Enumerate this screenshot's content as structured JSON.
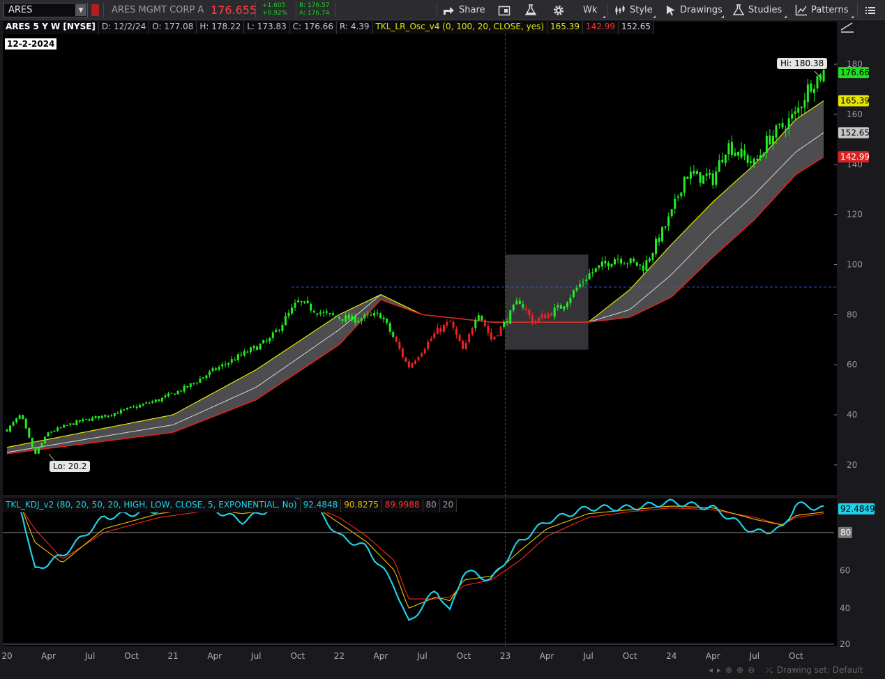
{
  "toolbar": {
    "symbol": "ARES",
    "company": "ARES MGMT CORP A",
    "last": "176.655",
    "change": "+1.605",
    "change_pct": "+0.92%",
    "bid": "B: 176.57",
    "ask": "A: 176.74",
    "share": "Share",
    "timeframe": "Wk",
    "style": "Style",
    "drawings": "Drawings",
    "studies": "Studies",
    "patterns": "Patterns",
    "icons": [
      "share-icon",
      "calendar-icon",
      "flask-icon",
      "gear-icon",
      "style-icon",
      "drawings-icon",
      "studies-icon",
      "patterns-icon",
      "menu-icon"
    ]
  },
  "legend": {
    "title": "ARES 5 Y W [NYSE]",
    "date": "D: 12/2/24",
    "open": "O: 177.08",
    "high": "H: 178.22",
    "low": "L: 173.83",
    "close": "C: 176.66",
    "range": "R: 4.39",
    "study": "TKL_LR_Osc_v4 (0, 100, 20, CLOSE, yes)",
    "study_v1": "165.39",
    "study_v2": "142.99",
    "study_v3": "152.65",
    "date_badge": "12-2-2024",
    "hi_label": "Hi: 180.38",
    "lo_label": "Lo: 20.2"
  },
  "kdj": {
    "title": "TKL_KDJ_v2 (80, 20, 50, 20, HIGH, LOW, CLOSE, 5, EXPONENTIAL, No)",
    "v1": "92.4848",
    "v2": "90.8275",
    "v3": "89.9988",
    "v4": "80",
    "v5": "20",
    "badge_value": "92.4849",
    "badge_80": "80"
  },
  "price_axis": {
    "ticks": [
      20,
      40,
      60,
      80,
      100,
      120,
      140,
      160,
      180
    ],
    "badges": [
      {
        "value": "176.66",
        "color": "#22dd22",
        "text_color": "#000"
      },
      {
        "value": "165.39",
        "color": "#e6e600",
        "text_color": "#000"
      },
      {
        "value": "152.65",
        "color": "#c8c8c8",
        "text_color": "#000"
      },
      {
        "value": "142.99",
        "color": "#dd2222",
        "text_color": "#fff"
      }
    ]
  },
  "kdj_axis": {
    "ticks": [
      20,
      40,
      60,
      80
    ]
  },
  "time_axis": [
    "20",
    "Apr",
    "Jul",
    "Oct",
    "21",
    "Apr",
    "Jul",
    "Oct",
    "22",
    "Apr",
    "Jul",
    "Oct",
    "23",
    "Apr",
    "Jul",
    "Oct",
    "24",
    "Apr",
    "Jul",
    "Oct"
  ],
  "status": {
    "drawing_set": "Drawing set: Default"
  },
  "chart_data": {
    "type": "candlestick",
    "title": "ARES 5 Y W [NYSE]",
    "price_range": [
      8,
      197
    ],
    "kdj_range": [
      20,
      98
    ],
    "reference_level": 91,
    "highlight_box": {
      "from": "2023-01",
      "to": "2023-07",
      "low": 66,
      "high": 104
    },
    "close_anchors": [
      [
        "2020-01",
        34
      ],
      [
        "2020-02",
        40
      ],
      [
        "2020-03",
        24
      ],
      [
        "2020-04",
        33
      ],
      [
        "2020-06",
        37
      ],
      [
        "2020-09",
        41
      ],
      [
        "2020-12",
        46
      ],
      [
        "2021-02",
        51
      ],
      [
        "2021-04",
        58
      ],
      [
        "2021-06",
        64
      ],
      [
        "2021-08",
        70
      ],
      [
        "2021-10",
        85
      ],
      [
        "2021-12",
        80
      ],
      [
        "2022-02",
        78
      ],
      [
        "2022-04",
        80
      ],
      [
        "2022-05",
        70
      ],
      [
        "2022-06",
        59
      ],
      [
        "2022-08",
        73
      ],
      [
        "2022-09",
        77
      ],
      [
        "2022-10",
        65
      ],
      [
        "2022-11",
        82
      ],
      [
        "2022-12",
        70
      ],
      [
        "2023-01",
        77
      ],
      [
        "2023-02",
        86
      ],
      [
        "2023-03",
        77
      ],
      [
        "2023-05",
        83
      ],
      [
        "2023-07",
        96
      ],
      [
        "2023-09",
        103
      ],
      [
        "2023-11",
        99
      ],
      [
        "2024-01",
        120
      ],
      [
        "2024-02",
        136
      ],
      [
        "2024-04",
        134
      ],
      [
        "2024-05",
        148
      ],
      [
        "2024-07",
        140
      ],
      [
        "2024-08",
        150
      ],
      [
        "2024-10",
        160
      ],
      [
        "2024-11",
        172
      ],
      [
        "2024-12",
        176.66
      ]
    ],
    "lr_band_anchors": [
      [
        "2020-01",
        27,
        25,
        24.5
      ],
      [
        "2021-01",
        40,
        36,
        33
      ],
      [
        "2021-07",
        58,
        51,
        46
      ],
      [
        "2022-01",
        80,
        74,
        68
      ],
      [
        "2022-04",
        88,
        88,
        86
      ],
      [
        "2022-07",
        80,
        80,
        80
      ],
      [
        "2022-12",
        77,
        77,
        77
      ],
      [
        "2023-07",
        77,
        77,
        77
      ],
      [
        "2023-10",
        90,
        82,
        79
      ],
      [
        "2024-01",
        108,
        96,
        87
      ],
      [
        "2024-04",
        125,
        113,
        103
      ],
      [
        "2024-07",
        140,
        128,
        118
      ],
      [
        "2024-10",
        158,
        145,
        136
      ],
      [
        "2024-12",
        165.39,
        152.65,
        142.99
      ]
    ],
    "kdj_anchors": [
      [
        "2020-01",
        96,
        95,
        94
      ],
      [
        "2020-02",
        94,
        94,
        93
      ],
      [
        "2020-03",
        60,
        75,
        82
      ],
      [
        "2020-05",
        68,
        64,
        66
      ],
      [
        "2020-08",
        88,
        82,
        80
      ],
      [
        "2020-12",
        92,
        90,
        88
      ],
      [
        "2021-03",
        95,
        93,
        91
      ],
      [
        "2021-06",
        86,
        90,
        91
      ],
      [
        "2021-09",
        96,
        93,
        92
      ],
      [
        "2021-11",
        96,
        95,
        94
      ],
      [
        "2022-01",
        78,
        85,
        88
      ],
      [
        "2022-03",
        72,
        75,
        78
      ],
      [
        "2022-05",
        52,
        60,
        65
      ],
      [
        "2022-06",
        32,
        40,
        45
      ],
      [
        "2022-08",
        50,
        46,
        45
      ],
      [
        "2022-09",
        38,
        44,
        46
      ],
      [
        "2022-10",
        60,
        55,
        52
      ],
      [
        "2022-12",
        55,
        57,
        55
      ],
      [
        "2023-02",
        75,
        70,
        65
      ],
      [
        "2023-04",
        86,
        82,
        78
      ],
      [
        "2023-07",
        93,
        90,
        88
      ],
      [
        "2023-10",
        93,
        92,
        91
      ],
      [
        "2024-01",
        96,
        94,
        93
      ],
      [
        "2024-04",
        93,
        93,
        92
      ],
      [
        "2024-07",
        80,
        87,
        88
      ],
      [
        "2024-09",
        82,
        84,
        84
      ],
      [
        "2024-10",
        95,
        89,
        88
      ],
      [
        "2024-12",
        92.48,
        90.83,
        90.0
      ]
    ]
  }
}
